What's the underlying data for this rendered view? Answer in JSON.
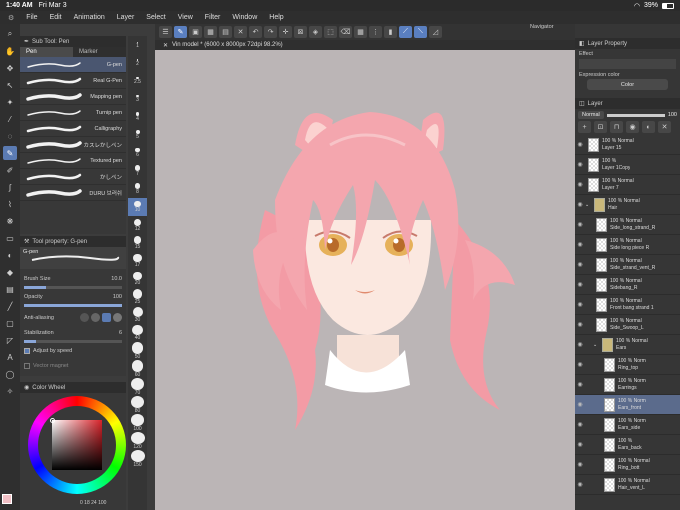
{
  "status": {
    "time": "1:40 AM",
    "date": "Fri Mar 3",
    "battery": "39%"
  },
  "menu": [
    "File",
    "Edit",
    "Animation",
    "Layer",
    "Select",
    "View",
    "Filter",
    "Window",
    "Help"
  ],
  "document_tab": "Vin model * (6000 x 8000px 72dpi 98.2%)",
  "navigator_label": "Navigator",
  "subtool": {
    "header": "Sub Tool: Pen",
    "tabs": [
      "Pen",
      "Marker"
    ],
    "brushes": [
      "G-pen",
      "Real G-Pen",
      "Mapping pen",
      "Turnip pen",
      "Calligraphy",
      "カスレかしペン",
      "Textured pen",
      "かしペン",
      "DURU 브러쉬"
    ]
  },
  "size_column": [
    "1",
    "2",
    "2.5",
    "3",
    "4",
    "5",
    "6",
    "7",
    "8",
    "10",
    "12",
    "15",
    "17",
    "20",
    "25",
    "30",
    "40",
    "50",
    "60",
    "70",
    "80",
    "100",
    "120",
    "150"
  ],
  "toolprop": {
    "header": "Tool property: G-pen",
    "tool_name": "G-pen",
    "brush_size_label": "Brush Size",
    "brush_size_value": "10.0",
    "opacity_label": "Opacity",
    "opacity_value": "100",
    "antialias_label": "Anti-aliasing",
    "stabilization_label": "Stabilization",
    "stabilization_value": "6",
    "adjust_label": "Adjust by speed",
    "vector_label": "Vector magnet"
  },
  "colorwheel": {
    "header": "Color Wheel",
    "values": "0 18 24 100"
  },
  "right": {
    "layer_property": "Layer Property",
    "effect_label": "Effect",
    "expression_label": "Expression color",
    "expression_value": "Color",
    "layer_label": "Layer",
    "blend_mode": "Normal",
    "opacity": "100"
  },
  "layers": [
    {
      "pct": "100 %",
      "mode": "Normal",
      "name": "Layer 15",
      "type": "layer"
    },
    {
      "pct": "100 %",
      "mode": "",
      "name": "Layer 1Copy",
      "type": "layer"
    },
    {
      "pct": "100 %",
      "mode": "Normal",
      "name": "Layer 7",
      "type": "layer"
    },
    {
      "pct": "100 %",
      "mode": "Normal",
      "name": "Hair",
      "type": "folder"
    },
    {
      "pct": "100 %",
      "mode": "Normal",
      "name": "Side_long_strand_R",
      "type": "layer"
    },
    {
      "pct": "100 %",
      "mode": "Normal",
      "name": "Side long piece R",
      "type": "layer"
    },
    {
      "pct": "100 %",
      "mode": "Normal",
      "name": "Side_strand_vent_R",
      "type": "layer"
    },
    {
      "pct": "100 %",
      "mode": "Normal",
      "name": "Sidebang_R",
      "type": "layer"
    },
    {
      "pct": "100 %",
      "mode": "Normal",
      "name": "Front bang strand 1",
      "type": "layer"
    },
    {
      "pct": "100 %",
      "mode": "Normal",
      "name": "Side_Swoop_L",
      "type": "layer"
    },
    {
      "pct": "100 %",
      "mode": "Normal",
      "name": "Ears",
      "type": "folder"
    },
    {
      "pct": "100 %",
      "mode": "Norm",
      "name": "Ring_top",
      "type": "layer"
    },
    {
      "pct": "100 %",
      "mode": "Norm",
      "name": "Earrings",
      "type": "layer"
    },
    {
      "pct": "100 %",
      "mode": "Norm",
      "name": "Ears_front",
      "type": "layer",
      "sel": true
    },
    {
      "pct": "100 %",
      "mode": "Norm",
      "name": "Ears_side",
      "type": "layer"
    },
    {
      "pct": "100 %",
      "mode": "",
      "name": "Ears_back",
      "type": "layer"
    },
    {
      "pct": "100 %",
      "mode": "Normal",
      "name": "Ring_bott",
      "type": "layer"
    },
    {
      "pct": "100 %",
      "mode": "Normal",
      "name": "Hair_vent_L",
      "type": "layer"
    }
  ],
  "colors": {
    "accent": "#5b7bb3",
    "canvas_bg": "#bbb5b6",
    "hair": "#f4a6ae",
    "fg_color": "#f2c0c6"
  }
}
